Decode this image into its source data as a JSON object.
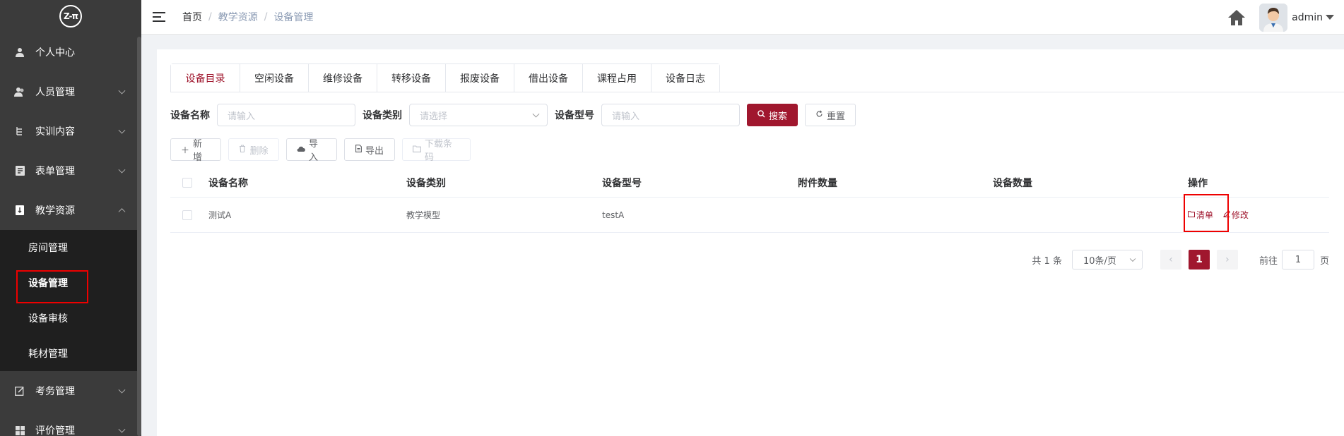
{
  "sidebar": {
    "logo": "Z-π",
    "items": [
      {
        "label": "个人中心",
        "icon": "user-icon"
      },
      {
        "label": "人员管理",
        "icon": "users-icon"
      },
      {
        "label": "实训内容",
        "icon": "tree-icon"
      },
      {
        "label": "表单管理",
        "icon": "form-icon"
      },
      {
        "label": "教学资源",
        "icon": "book-icon"
      },
      {
        "label": "考务管理",
        "icon": "edit-icon"
      },
      {
        "label": "评价管理",
        "icon": "grid-icon"
      }
    ],
    "submenu": [
      {
        "label": "房间管理"
      },
      {
        "label": "设备管理"
      },
      {
        "label": "设备审核"
      },
      {
        "label": "耗材管理"
      }
    ]
  },
  "header": {
    "breadcrumb": [
      "首页",
      "教学资源",
      "设备管理"
    ],
    "username": "admin"
  },
  "tabs": [
    "设备目录",
    "空闲设备",
    "维修设备",
    "转移设备",
    "报废设备",
    "借出设备",
    "课程占用",
    "设备日志"
  ],
  "filters": {
    "name_label": "设备名称",
    "name_placeholder": "请输入",
    "type_label": "设备类别",
    "type_placeholder": "请选择",
    "model_label": "设备型号",
    "model_placeholder": "请输入",
    "search_label": "搜索",
    "reset_label": "重置"
  },
  "toolbar": {
    "add": "新增",
    "delete": "删除",
    "import": "导入",
    "export": "导出",
    "download_barcode": "下载条码"
  },
  "table": {
    "columns": [
      "设备名称",
      "设备类别",
      "设备型号",
      "附件数量",
      "设备数量",
      "操作"
    ],
    "rows": [
      {
        "name": "测试A",
        "type": "教学模型",
        "model": "testA",
        "attachments": "",
        "quantity": "",
        "ops": [
          "清单",
          "修改"
        ]
      }
    ]
  },
  "pagination": {
    "total": "共 1 条",
    "page_size": "10条/页",
    "current": "1",
    "goto_label": "前往",
    "goto_value": "1",
    "page_suffix": "页"
  },
  "colors": {
    "accent": "#a0172e",
    "sidebar_bg": "#3b3b3b",
    "submenu_bg": "#1f1f1f",
    "highlight_box": "#e00000"
  }
}
